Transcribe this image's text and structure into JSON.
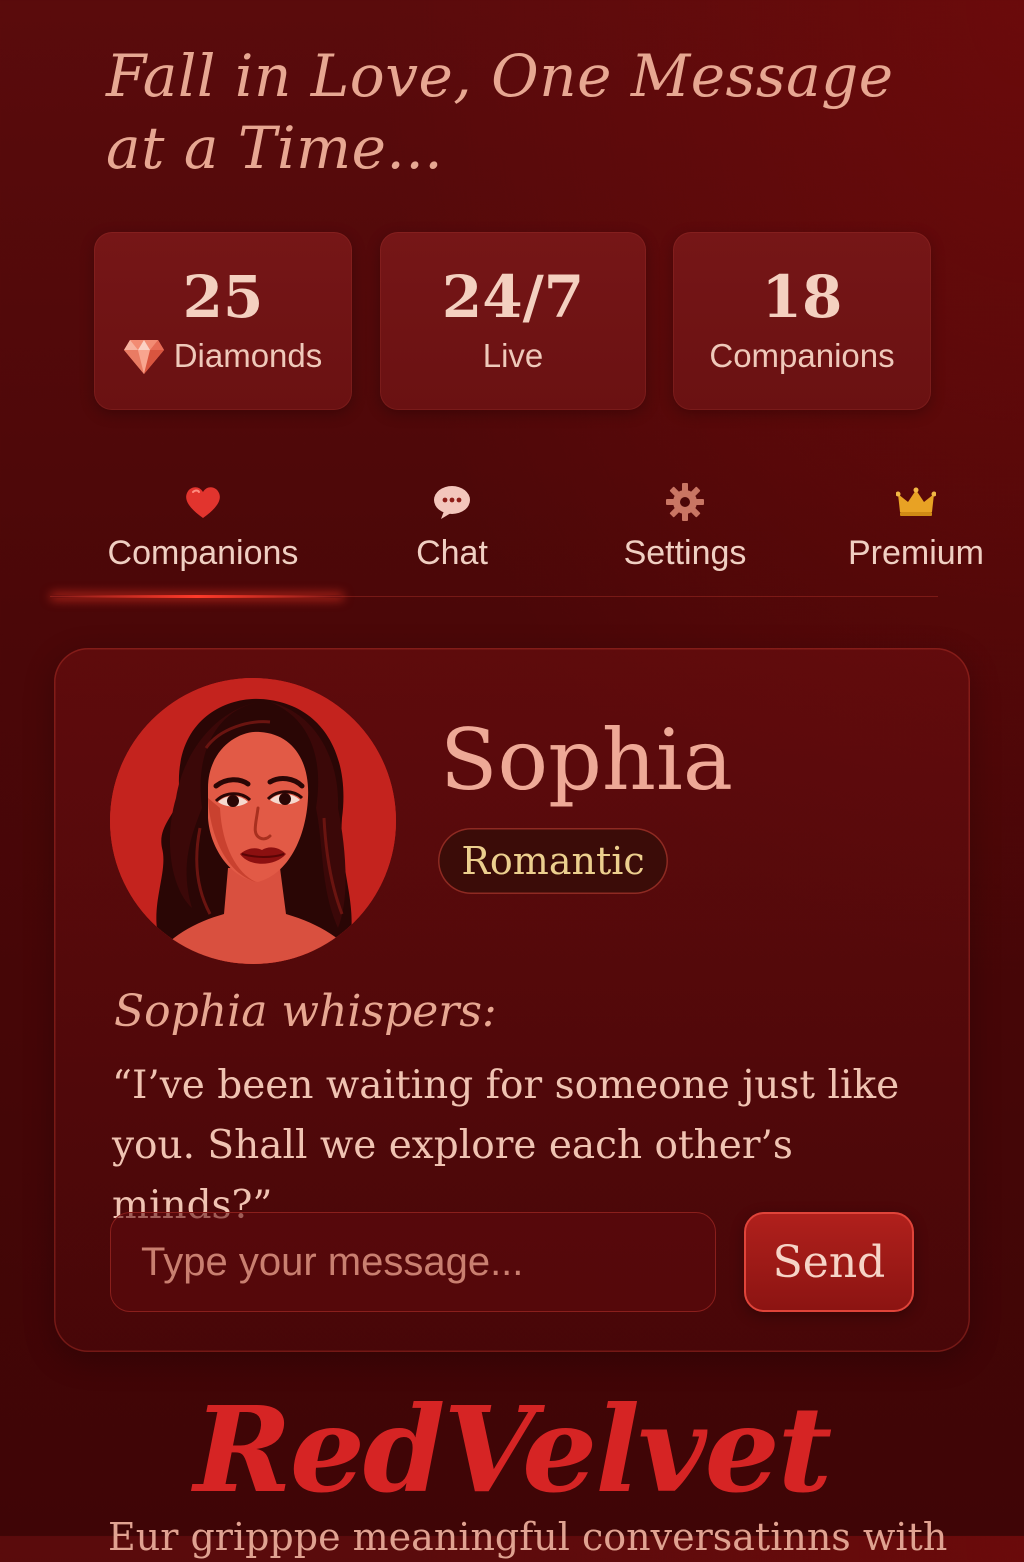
{
  "header": {
    "headline": "Fall in Love, One Message at a Time..."
  },
  "stats": [
    {
      "value": "25",
      "label": "Diamonds",
      "icon": "diamond-icon"
    },
    {
      "value": "24/7",
      "label": "Live"
    },
    {
      "value": "18",
      "label": "Companions"
    }
  ],
  "tabs": [
    {
      "label": "Companions",
      "icon": "heart-icon",
      "active": true
    },
    {
      "label": "Chat",
      "icon": "chat-bubble-icon",
      "active": false
    },
    {
      "label": "Settings",
      "icon": "gear-icon",
      "active": false
    },
    {
      "label": "Premium",
      "icon": "crown-icon",
      "active": false
    }
  ],
  "companion": {
    "name": "Sophia",
    "mood": "Romantic",
    "whisper_title": "Sophia whispers:",
    "whisper_text": "“I’ve been waiting for someone just like you. Shall we explore each other’s minds?”"
  },
  "composer": {
    "placeholder": "Type your message...",
    "value": "",
    "send_label": "Send"
  },
  "footer": {
    "brand": "RedVelvet",
    "tagline": "Eur gripppe meaningful conversatinns with"
  },
  "colors": {
    "background": "#4b0708",
    "accent": "#d62424",
    "card": "#6a1112",
    "text": "#f0c3b2",
    "badge_text": "#eccf8e"
  }
}
